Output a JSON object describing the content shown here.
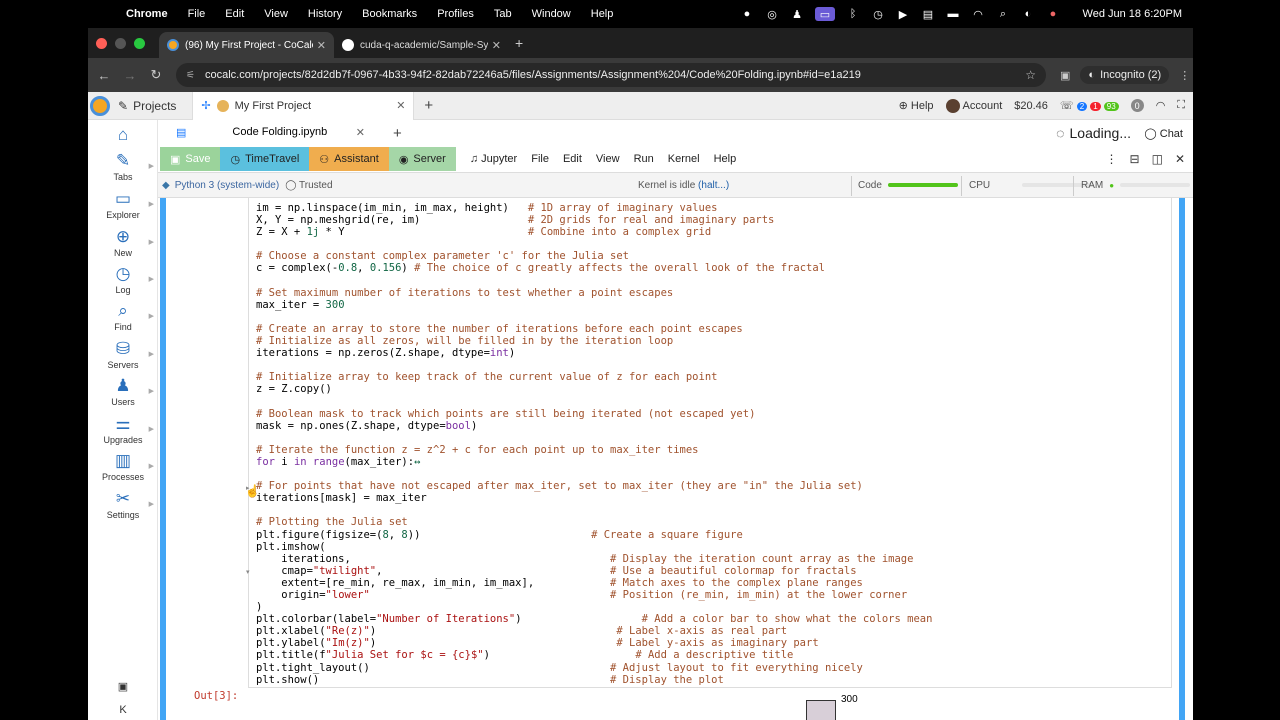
{
  "macos": {
    "app": "Chrome",
    "menus": [
      "File",
      "Edit",
      "View",
      "History",
      "Bookmarks",
      "Profiles",
      "Tab",
      "Window",
      "Help"
    ],
    "clock": "Wed Jun 18  6:20PM"
  },
  "browser": {
    "tabs": [
      {
        "title": "(96) My First Project - CoCalc"
      },
      {
        "title": "cuda-q-academic/Sample-Sy..."
      }
    ],
    "url": "cocalc.com/projects/82d2db7f-0967-4b33-94f2-82dab72246a5/files/Assignments/Assignment%204/Code%20Folding.ipynb#id=e1a219",
    "incognito_label": "Incognito (2)"
  },
  "cocalc": {
    "projects_label": "Projects",
    "project_tab": "My First Project",
    "help": "Help",
    "account": "Account",
    "balance": "$20.46",
    "badge_blue": "2",
    "badge_red": "1",
    "badge_green": "93",
    "badge_grey": "0",
    "file_tab": "Code Folding.ipynb",
    "loading": "Loading...",
    "chat": "Chat"
  },
  "sidebar": {
    "items": [
      {
        "label": ""
      },
      {
        "label": "Tabs"
      },
      {
        "label": "Explorer"
      },
      {
        "label": "New"
      },
      {
        "label": "Log"
      },
      {
        "label": "Find"
      },
      {
        "label": "Servers"
      },
      {
        "label": "Users"
      },
      {
        "label": "Upgrades"
      },
      {
        "label": "Processes"
      },
      {
        "label": "Settings"
      }
    ]
  },
  "toolbar": {
    "save": "Save",
    "timetravel": "TimeTravel",
    "assistant": "Assistant",
    "server": "Server",
    "jupyter": "Jupyter",
    "menus": [
      "File",
      "Edit",
      "View",
      "Run",
      "Kernel",
      "Help"
    ]
  },
  "kernel": {
    "name": "Python 3 (system-wide)",
    "trusted": "Trusted",
    "status": "Kernel is idle",
    "halt": "(halt...)",
    "code": "Code",
    "cpu": "CPU",
    "ram": "RAM"
  },
  "code_lines": [
    [
      [
        "b",
        "im = np.linspace(im_min, im_max, height)   "
      ],
      [
        "c",
        "# 1D array of imaginary values"
      ]
    ],
    [
      [
        "b",
        "X, Y = np.meshgrid(re, im)                 "
      ],
      [
        "c",
        "# 2D grids for real and imaginary parts"
      ]
    ],
    [
      [
        "b",
        "Z = X + "
      ],
      [
        "n",
        "1j"
      ],
      [
        "b",
        " * Y                             "
      ],
      [
        "c",
        "# Combine into a complex grid"
      ]
    ],
    [
      [
        "b",
        ""
      ]
    ],
    [
      [
        "c",
        "# Choose a constant complex parameter 'c' for the Julia set"
      ]
    ],
    [
      [
        "b",
        "c = complex(-"
      ],
      [
        "n",
        "0.8"
      ],
      [
        "b",
        ", "
      ],
      [
        "n",
        "0.156"
      ],
      [
        "b",
        ") "
      ],
      [
        "c",
        "# The choice of c greatly affects the overall look of the fractal"
      ]
    ],
    [
      [
        "b",
        ""
      ]
    ],
    [
      [
        "c",
        "# Set maximum number of iterations to test whether a point escapes"
      ]
    ],
    [
      [
        "b",
        "max_iter = "
      ],
      [
        "n",
        "300"
      ]
    ],
    [
      [
        "b",
        ""
      ]
    ],
    [
      [
        "c",
        "# Create an array to store the number of iterations before each point escapes"
      ]
    ],
    [
      [
        "c",
        "# Initialize as all zeros, will be filled in by the iteration loop"
      ]
    ],
    [
      [
        "b",
        "iterations = np.zeros(Z.shape, dtype="
      ],
      [
        "k",
        "int"
      ],
      [
        "b",
        ")"
      ]
    ],
    [
      [
        "b",
        ""
      ]
    ],
    [
      [
        "c",
        "# Initialize array to keep track of the current value of z for each point"
      ]
    ],
    [
      [
        "b",
        "z = Z.copy()"
      ]
    ],
    [
      [
        "b",
        ""
      ]
    ],
    [
      [
        "c",
        "# Boolean mask to track which points are still being iterated (not escaped yet)"
      ]
    ],
    [
      [
        "b",
        "mask = np.ones(Z.shape, dtype="
      ],
      [
        "k",
        "bool"
      ],
      [
        "b",
        ")"
      ]
    ],
    [
      [
        "b",
        ""
      ]
    ],
    [
      [
        "c",
        "# Iterate the function z = z^2 + c for each point up to max_iter times"
      ]
    ],
    [
      [
        "k",
        "for"
      ],
      [
        "b",
        " i "
      ],
      [
        "k",
        "in"
      ],
      [
        "b",
        " "
      ],
      [
        "k",
        "range"
      ],
      [
        "b",
        "(max_iter):"
      ],
      [
        "n",
        "↔"
      ]
    ],
    [
      [
        "b",
        ""
      ]
    ],
    [
      [
        "c",
        "# For points that have not escaped after max_iter, set to max_iter (they are \"in\" the Julia set)"
      ]
    ],
    [
      [
        "b",
        "iterations[mask] = max_iter"
      ]
    ],
    [
      [
        "b",
        ""
      ]
    ],
    [
      [
        "c",
        "# Plotting the Julia set"
      ]
    ],
    [
      [
        "b",
        "plt.figure(figsize=("
      ],
      [
        "n",
        "8"
      ],
      [
        "b",
        ", "
      ],
      [
        "n",
        "8"
      ],
      [
        "b",
        "))                           "
      ],
      [
        "c",
        "# Create a square figure"
      ]
    ],
    [
      [
        "b",
        "plt.imshow("
      ]
    ],
    [
      [
        "b",
        "    iterations,                                         "
      ],
      [
        "c",
        "# Display the iteration count array as the image"
      ]
    ],
    [
      [
        "b",
        "    cmap="
      ],
      [
        "s",
        "\"twilight\""
      ],
      [
        "b",
        ",                                    "
      ],
      [
        "c",
        "# Use a beautiful colormap for fractals"
      ]
    ],
    [
      [
        "b",
        "    extent=[re_min, re_max, im_min, im_max],            "
      ],
      [
        "c",
        "# Match axes to the complex plane ranges"
      ]
    ],
    [
      [
        "b",
        "    origin="
      ],
      [
        "s",
        "\"lower\""
      ],
      [
        "b",
        "                                      "
      ],
      [
        "c",
        "# Position (re_min, im_min) at the lower corner"
      ]
    ],
    [
      [
        "b",
        ")"
      ]
    ],
    [
      [
        "b",
        "plt.colorbar(label="
      ],
      [
        "s",
        "\"Number of Iterations\""
      ],
      [
        "b",
        ")                   "
      ],
      [
        "c",
        "# Add a color bar to show what the colors mean"
      ]
    ],
    [
      [
        "b",
        "plt.xlabel("
      ],
      [
        "s",
        "\"Re(z)\""
      ],
      [
        "b",
        ")                                      "
      ],
      [
        "c",
        "# Label x-axis as real part"
      ]
    ],
    [
      [
        "b",
        "plt.ylabel("
      ],
      [
        "s",
        "\"Im(z)\""
      ],
      [
        "b",
        ")                                      "
      ],
      [
        "c",
        "# Label y-axis as imaginary part"
      ]
    ],
    [
      [
        "b",
        "plt.title(f"
      ],
      [
        "s",
        "\"Julia Set for $c = {c}$\""
      ],
      [
        "b",
        ")                       "
      ],
      [
        "c",
        "# Add a descriptive title"
      ]
    ],
    [
      [
        "b",
        "plt.tight_layout()                                      "
      ],
      [
        "c",
        "# Adjust layout to fit everything nicely"
      ]
    ],
    [
      [
        "b",
        "plt.show()                                              "
      ],
      [
        "c",
        "# Display the plot"
      ]
    ]
  ],
  "output": {
    "prompt": "Out[3]:",
    "tick_label": "300"
  }
}
